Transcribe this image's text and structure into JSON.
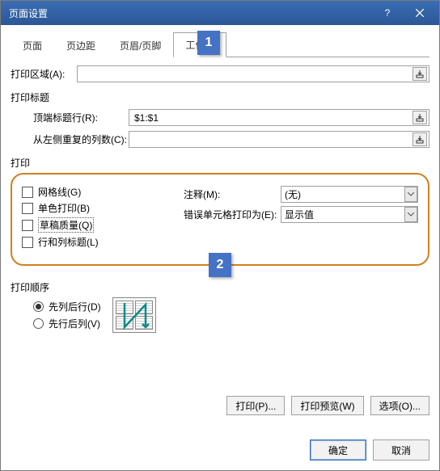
{
  "window": {
    "title": "页面设置"
  },
  "tabs": {
    "page": "页面",
    "margin": "页边距",
    "headerfooter": "页眉/页脚",
    "sheet": "工作表"
  },
  "callouts": {
    "one": "1",
    "two": "2"
  },
  "printArea": {
    "label": "打印区域(A):",
    "value": ""
  },
  "titles": {
    "groupLabel": "打印标题",
    "rows": {
      "label": "顶端标题行(R):",
      "value": "$1:$1"
    },
    "cols": {
      "label": "从左侧重复的列数(C):",
      "value": ""
    }
  },
  "print": {
    "groupLabel": "打印",
    "gridlines": "网格线(G)",
    "bw": "单色打印(B)",
    "draft": "草稿质量(Q)",
    "headers": "行和列标题(L)",
    "comments": {
      "label": "注释(M):",
      "value": "(无)"
    },
    "errors": {
      "label": "错误单元格打印为(E):",
      "value": "显示值"
    }
  },
  "order": {
    "groupLabel": "打印顺序",
    "downOver": "先列后行(D)",
    "overDown": "先行后列(V)"
  },
  "buttons": {
    "print": "打印(P)...",
    "preview": "打印预览(W)",
    "options": "选项(O)..."
  },
  "footer": {
    "ok": "确定",
    "cancel": "取消"
  }
}
